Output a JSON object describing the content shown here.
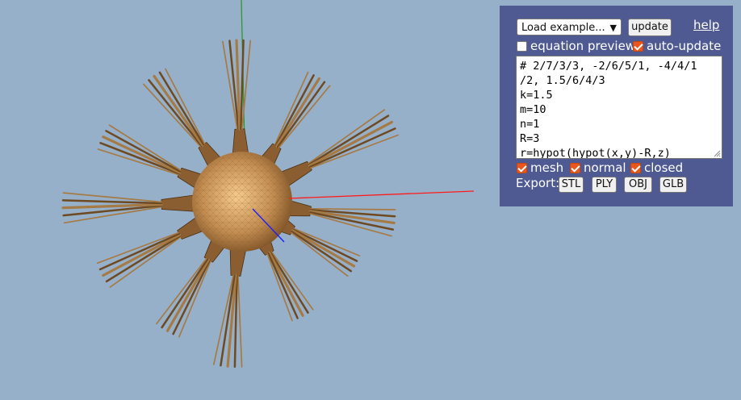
{
  "panel": {
    "example_select": "Load example...",
    "update_label": "update",
    "help_label": "help",
    "equation_preview": {
      "label": "equation preview",
      "checked": false
    },
    "auto_update": {
      "label": "auto-update",
      "checked": true
    },
    "code_lines": [
      "# 2/7/3/3, -2/6/5/1, -4/4/1",
      "/2, 1.5/6/4/3",
      "k=1.5",
      "m=10",
      "n=1",
      "R=3",
      "r=hypot(hypot(x,y)-R,z)"
    ],
    "mesh": {
      "label": "mesh",
      "checked": true
    },
    "normal": {
      "label": "normal",
      "checked": true
    },
    "closed": {
      "label": "closed",
      "checked": true
    },
    "export_label": "Export:",
    "export_buttons": [
      "STL",
      "PLY",
      "OBJ",
      "GLB"
    ]
  },
  "colors": {
    "background": "#97b0ca",
    "panel": "#4f5a93",
    "checkbox_accent": "#e8581e",
    "model": "#9c6e3c",
    "axis_x": "#ff0000",
    "axis_y": "#00aa00",
    "axis_z": "#0000ff"
  }
}
